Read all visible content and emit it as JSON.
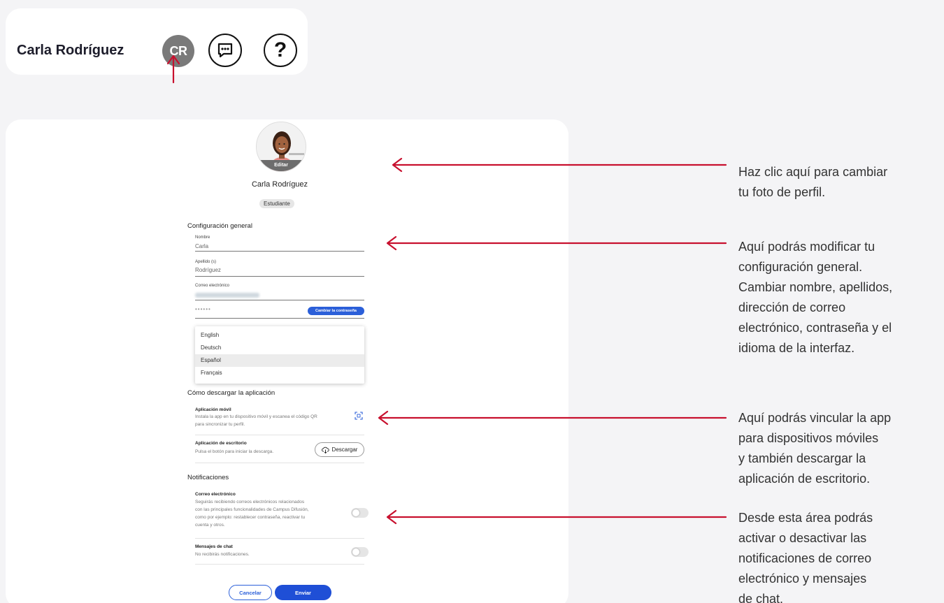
{
  "header": {
    "user_name": "Carla Rodríguez",
    "avatar_initials": "CR",
    "help_glyph": "?"
  },
  "profile": {
    "edit_label": "Editar",
    "name": "Carla Rodríguez",
    "role": "Estudiante"
  },
  "general": {
    "title": "Configuración general",
    "first_name_label": "Nombre",
    "first_name_value": "Carla",
    "last_name_label": "Apellido (s)",
    "last_name_value": "Rodríguez",
    "email_label": "Correo electrónico",
    "password_mask": "••••••",
    "change_password_label": "Cambiar la contraseña",
    "languages": [
      "English",
      "Deutsch",
      "Español",
      "Français"
    ],
    "selected_language": "Español"
  },
  "app": {
    "title": "Cómo descargar la aplicación",
    "mobile_title": "Aplicación móvil",
    "mobile_desc_line1": "Instala la app en tu dispositivo móvil y escanea el código QR",
    "mobile_desc_line2": "para sincronizar tu perfil.",
    "desktop_title": "Aplicación de escritorio",
    "desktop_desc": "Pulsa el botón para iniciar la descarga.",
    "download_label": "Descargar"
  },
  "notifications": {
    "title": "Notificaciones",
    "email_title": "Correo electrónico",
    "email_desc_line1": "Seguirás recibiendo correos electrónicos relacionados",
    "email_desc_line2": "con las principales funcionalidades de Campus Difusión,",
    "email_desc_line3": "como por ejemplo: restablecer contraseña, reactivar tu",
    "email_desc_line4": "cuenta y otros.",
    "chat_title": "Mensajes de chat",
    "chat_desc": "No recibirás notificaciones."
  },
  "actions": {
    "cancel_label": "Cancelar",
    "send_label": "Enviar"
  },
  "callouts": {
    "photo_line1": "Haz clic aquí para cambiar",
    "photo_line2": "tu foto de perfil.",
    "general_line1": "Aquí podrás modificar tu",
    "general_line2": "configuración general.",
    "general_line3": "Cambiar nombre, apellidos,",
    "general_line4": "dirección de correo",
    "general_line5": "electrónico, contraseña y el",
    "general_line6": "idioma de la interfaz.",
    "app_line1": "Aquí podrás vincular la app",
    "app_line2": "para dispositivos móviles",
    "app_line3": "y también descargar la",
    "app_line4": "aplicación de escritorio.",
    "notif_line1": "Desde esta área podrás",
    "notif_line2": "activar o desactivar las",
    "notif_line3": "notificaciones de correo",
    "notif_line4": "electrónico y mensajes",
    "notif_line5": "de chat."
  },
  "colors": {
    "arrow": "#c8102e",
    "primary_button": "#1f4fd6",
    "avatar_bg": "#7a7a7a"
  }
}
